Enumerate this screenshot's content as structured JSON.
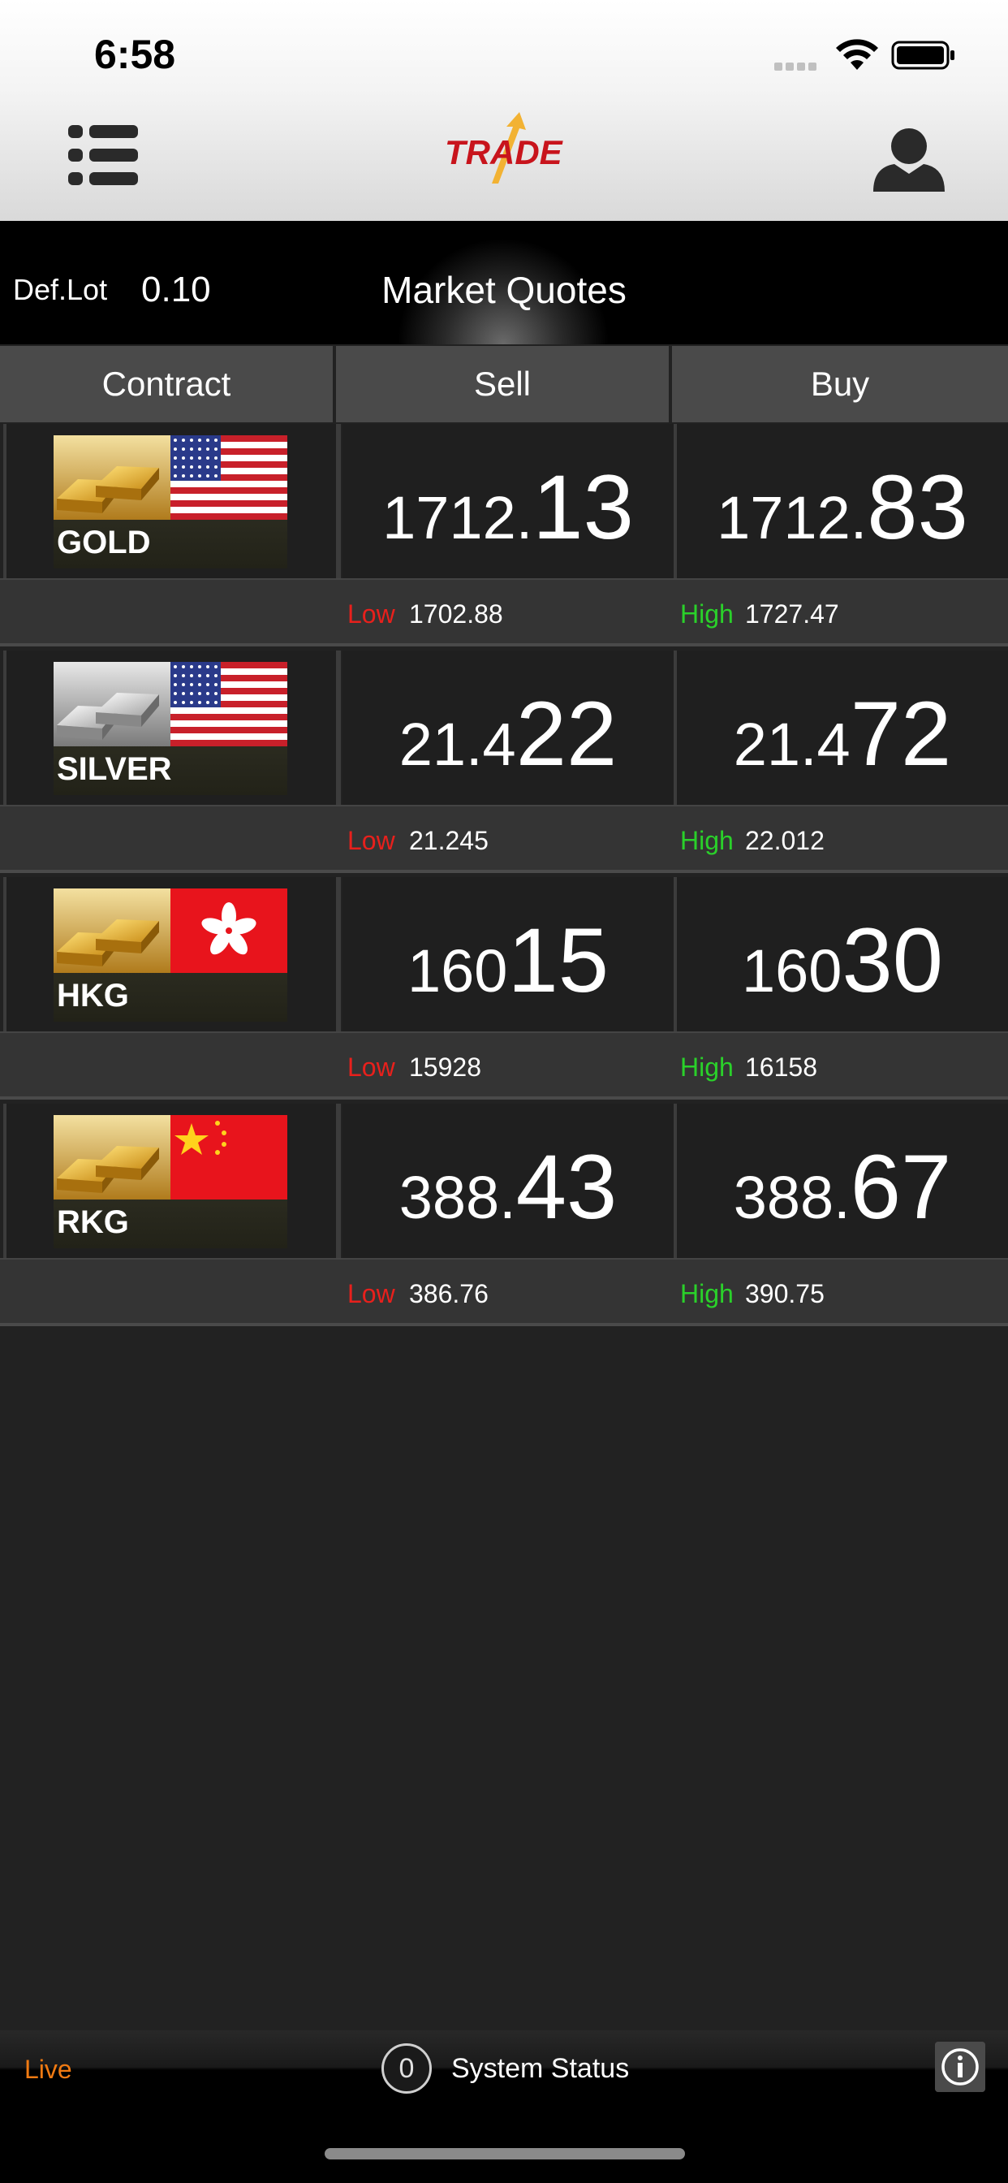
{
  "status_bar": {
    "time": "6:58"
  },
  "header": {
    "logo_text": "TRADE"
  },
  "title_bar": {
    "def_lot_label": "Def.Lot",
    "def_lot_value": "0.10",
    "title": "Market Quotes"
  },
  "table": {
    "columns": [
      "Contract",
      "Sell",
      "Buy"
    ],
    "rows": [
      {
        "name": "GOLD",
        "metal": "gold",
        "flag": "us-flag",
        "sell_prefix": "1712.",
        "sell_main": "13",
        "buy_prefix": "1712.",
        "buy_main": "83",
        "low_label": "Low",
        "low": "1702.88",
        "high_label": "High",
        "high": "1727.47"
      },
      {
        "name": "SILVER",
        "metal": "silver",
        "flag": "us-flag",
        "sell_prefix": "21.4",
        "sell_main": "22",
        "buy_prefix": "21.4",
        "buy_main": "72",
        "low_label": "Low",
        "low": "21.245",
        "high_label": "High",
        "high": "22.012"
      },
      {
        "name": "HKG",
        "metal": "gold",
        "flag": "hk-flag",
        "sell_prefix": "160",
        "sell_main": "15",
        "buy_prefix": "160",
        "buy_main": "30",
        "low_label": "Low",
        "low": "15928",
        "high_label": "High",
        "high": "16158"
      },
      {
        "name": "RKG",
        "metal": "gold",
        "flag": "cn-flag",
        "sell_prefix": "388.",
        "sell_main": "43",
        "buy_prefix": "388.",
        "buy_main": "67",
        "low_label": "Low",
        "low": "386.76",
        "high_label": "High",
        "high": "390.75"
      }
    ]
  },
  "bottom_bar": {
    "live_label": "Live",
    "system_status_count": "0",
    "system_status_label": "System Status"
  },
  "colors": {
    "low": "#e8201c",
    "high": "#2ad12a",
    "live": "#f07a12"
  },
  "icons": [
    "menu-icon",
    "user-icon",
    "info-icon",
    "wifi-icon",
    "battery-icon"
  ]
}
